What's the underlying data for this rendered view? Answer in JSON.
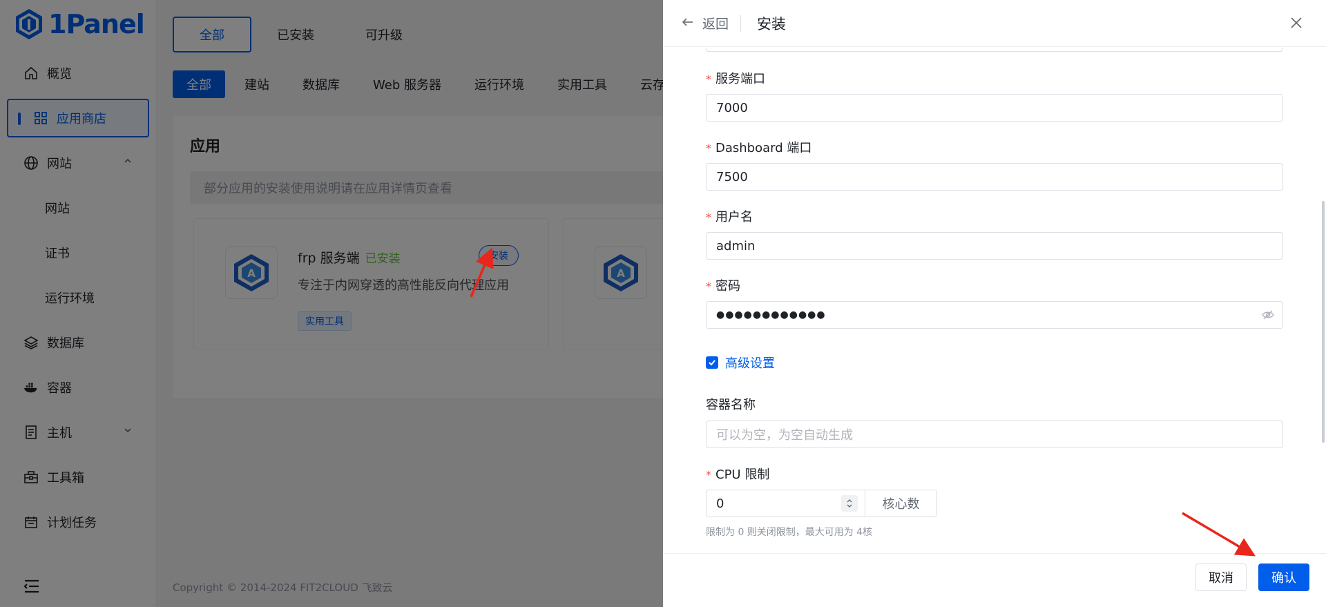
{
  "app": {
    "name": "1Panel"
  },
  "sidebar": {
    "items": [
      {
        "label": "概览",
        "icon": "home-icon"
      },
      {
        "label": "应用商店",
        "icon": "grid-icon",
        "active": true
      },
      {
        "label": "网站",
        "icon": "globe-icon",
        "expanded": true
      },
      {
        "label": "网站",
        "sub": true
      },
      {
        "label": "证书",
        "sub": true
      },
      {
        "label": "运行环境",
        "sub": true
      },
      {
        "label": "数据库",
        "icon": "layers-icon"
      },
      {
        "label": "容器",
        "icon": "docker-icon"
      },
      {
        "label": "主机",
        "icon": "server-icon",
        "expandable": true
      },
      {
        "label": "工具箱",
        "icon": "toolbox-icon"
      },
      {
        "label": "计划任务",
        "icon": "calendar-icon"
      }
    ]
  },
  "main": {
    "top_tabs": [
      "全部",
      "已安装",
      "可升级"
    ],
    "category_tabs": [
      "全部",
      "建站",
      "数据库",
      "Web 服务器",
      "运行环境",
      "实用工具",
      "云存"
    ],
    "apps_title": "应用",
    "notice": "部分应用的安装使用说明请在应用详情页查看",
    "app_card": {
      "name": "frp 服务端",
      "status": "已安装",
      "install_label": "安装",
      "description": "专注于内网穿透的高性能反向代理应用",
      "tag": "实用工具"
    },
    "footer": "Copyright © 2014-2024 FIT2CLOUD 飞致云"
  },
  "drawer": {
    "back_label": "返回",
    "title": "安装",
    "fields": {
      "service_port": {
        "label": "服务端口",
        "value": "7000"
      },
      "dashboard_port": {
        "label": "Dashboard 端口",
        "value": "7500"
      },
      "username": {
        "label": "用户名",
        "value": "admin"
      },
      "password": {
        "label": "密码",
        "value": "●●●●●●●●●●●●"
      },
      "advanced": {
        "label": "高级设置",
        "checked": true
      },
      "container_name": {
        "label": "容器名称",
        "placeholder": "可以为空，为空自动生成"
      },
      "cpu_limit": {
        "label": "CPU 限制",
        "value": "0",
        "unit": "核心数",
        "hint": "限制为 0 则关闭限制，最大可用为 4核"
      }
    },
    "cancel_label": "取消",
    "confirm_label": "确认"
  },
  "colors": {
    "primary": "#005eeb",
    "success": "#67c23a",
    "required": "#f54a45",
    "annotation": "#e8261c"
  }
}
